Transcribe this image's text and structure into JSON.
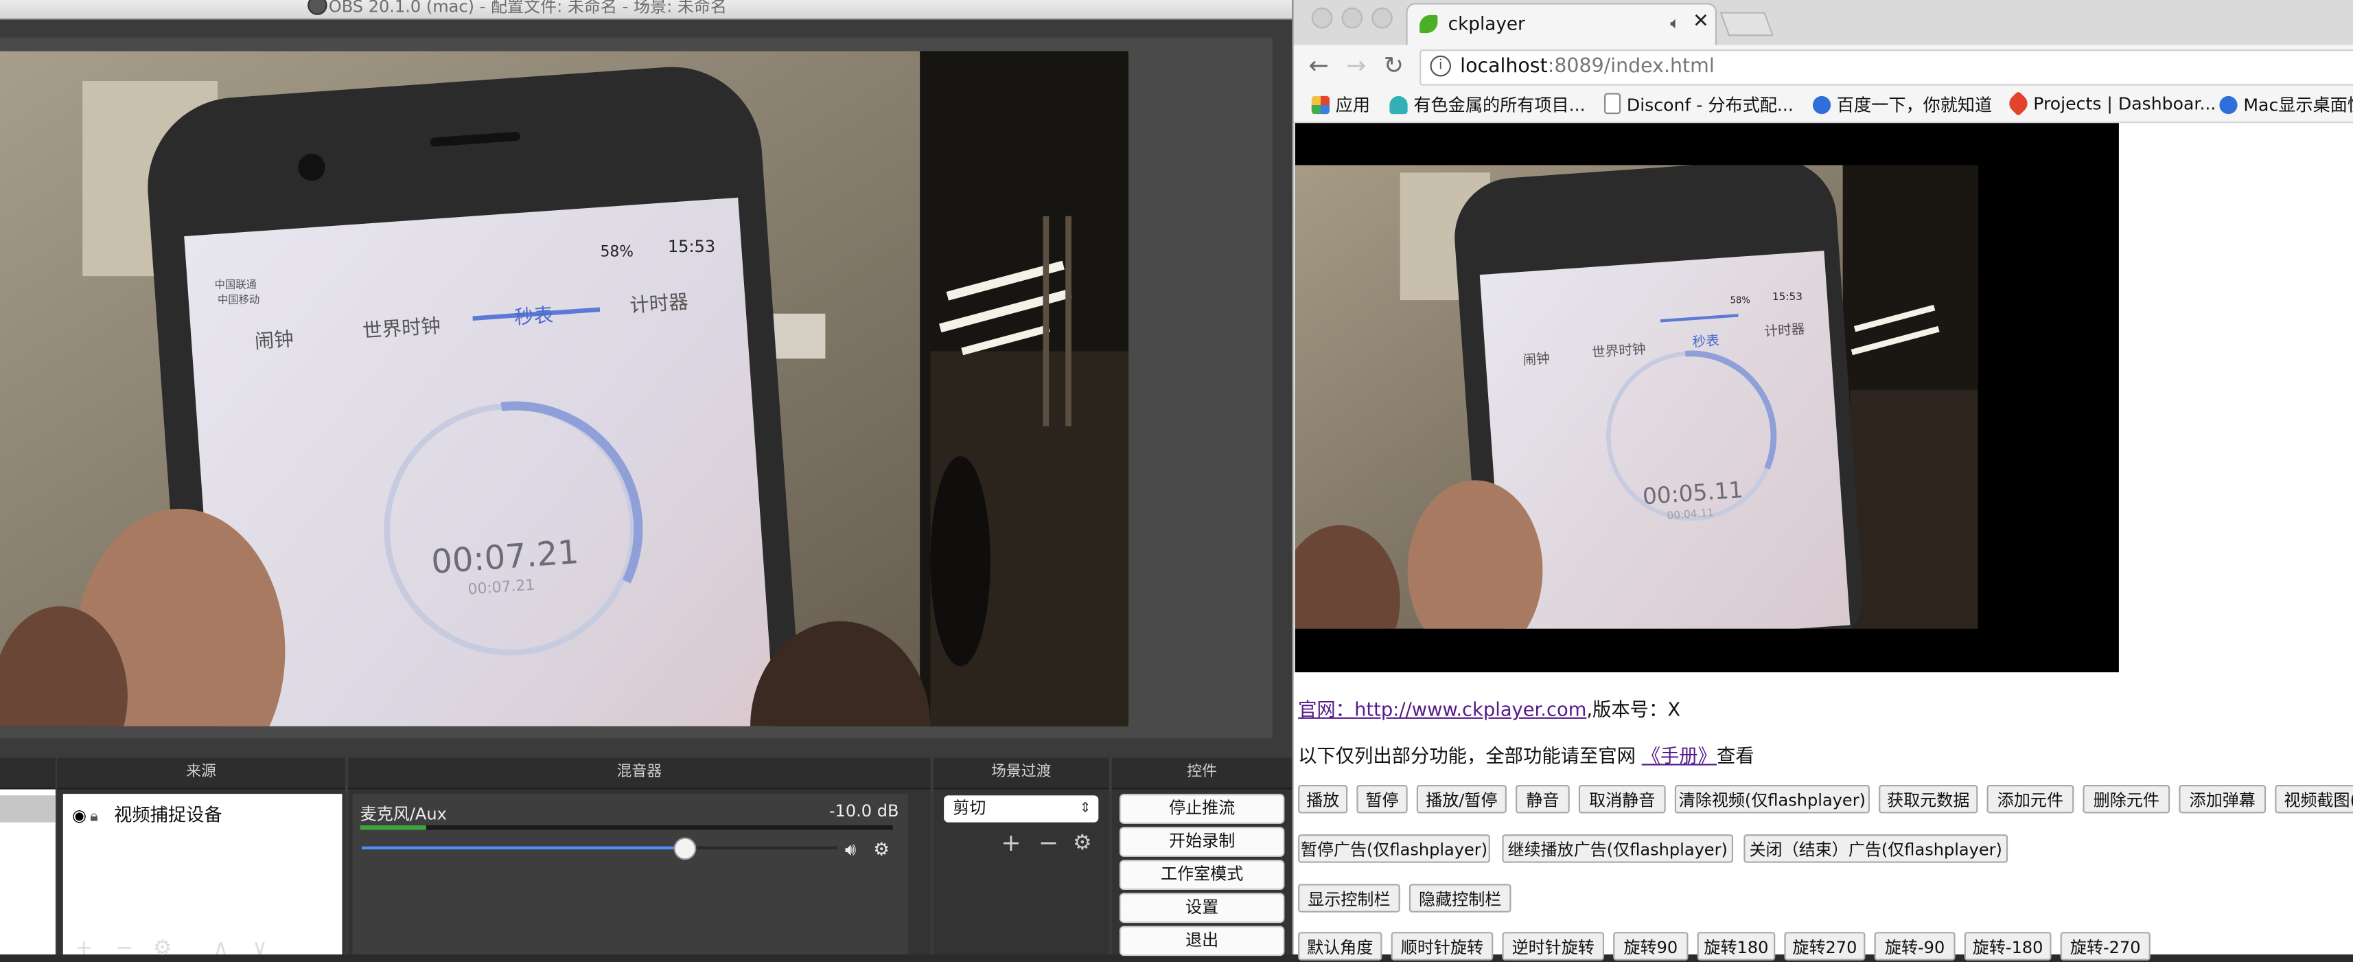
{
  "obs": {
    "title": "OBS 20.1.0 (mac) - 配置文件: 未命名 - 场景: 未命名",
    "panels": {
      "sources_header": "来源",
      "mixer_header": "混音器",
      "transitions_header": "场景过渡",
      "controls_header": "控件"
    },
    "preview_phone": {
      "status_time": "15:53",
      "battery": "58%",
      "carrier1": "中国联通",
      "carrier2": "中国移动",
      "tabs": [
        "闹钟",
        "世界时钟",
        "秒表",
        "计时器"
      ],
      "stopwatch": "00:07.21",
      "stopwatch_small": "00:07.21"
    },
    "sources": [
      {
        "label": "视频捕捉设备"
      }
    ],
    "mixer": {
      "channel": "麦克风/Aux",
      "level": "-10.0 dB",
      "volume_fraction": 0.68
    },
    "transition": {
      "selected": "剪切"
    },
    "controls": [
      "停止推流",
      "开始录制",
      "工作室模式",
      "设置",
      "退出"
    ]
  },
  "chrome": {
    "tab_title": "ckplayer",
    "url_host": "localhost",
    "url_rest": ":8089/index.html",
    "bookmarks": [
      {
        "label": "应用",
        "icon": "apps-grid-icon",
        "color": "#e3442c"
      },
      {
        "label": "有色金属的所有项目...",
        "icon": "project-icon",
        "color": "#31b0b5"
      },
      {
        "label": "Disconf - 分布式配...",
        "icon": "page-icon",
        "color": "#888888"
      },
      {
        "label": "百度一下，你就知道",
        "icon": "baidu-paw-icon",
        "color": "#2f6fdc"
      },
      {
        "label": "Projects | Dashboar...",
        "icon": "gitlab-icon",
        "color": "#e2432a"
      },
      {
        "label": "Mac显示桌面快",
        "icon": "baidu-paw-icon",
        "color": "#2f6fdc"
      }
    ],
    "video_phone": {
      "status_time": "15:53",
      "battery": "58%",
      "tabs": [
        "闹钟",
        "世界时钟",
        "秒表",
        "计时器"
      ],
      "stopwatch": "00:05.11",
      "stopwatch_small": "00:04.11"
    },
    "page": {
      "site_label": "官网：",
      "site_link": "http://www.ckplayer.com",
      "version_text": ",版本号：X",
      "feature_prefix": "以下仅列出部分功能，全部功能请至官网",
      "manual_link": "《手册》",
      "feature_suffix": "查看",
      "row1": [
        "播放",
        "暂停",
        "播放/暂停",
        "静音",
        "取消静音",
        "清除视频(仅flashplayer)",
        "获取元数据",
        "添加元件",
        "删除元件",
        "添加弹幕",
        "视频截图(仅"
      ],
      "row2": [
        "暂停广告(仅flashplayer)",
        "继续播放广告(仅flashplayer)",
        "关闭（结束）广告(仅flashplayer)"
      ],
      "row3": [
        "显示控制栏",
        "隐藏控制栏"
      ],
      "row4": [
        "默认角度",
        "顺时针旋转",
        "逆时针旋转",
        "旋转90",
        "旋转180",
        "旋转270",
        "旋转-90",
        "旋转-180",
        "旋转-270"
      ]
    }
  }
}
